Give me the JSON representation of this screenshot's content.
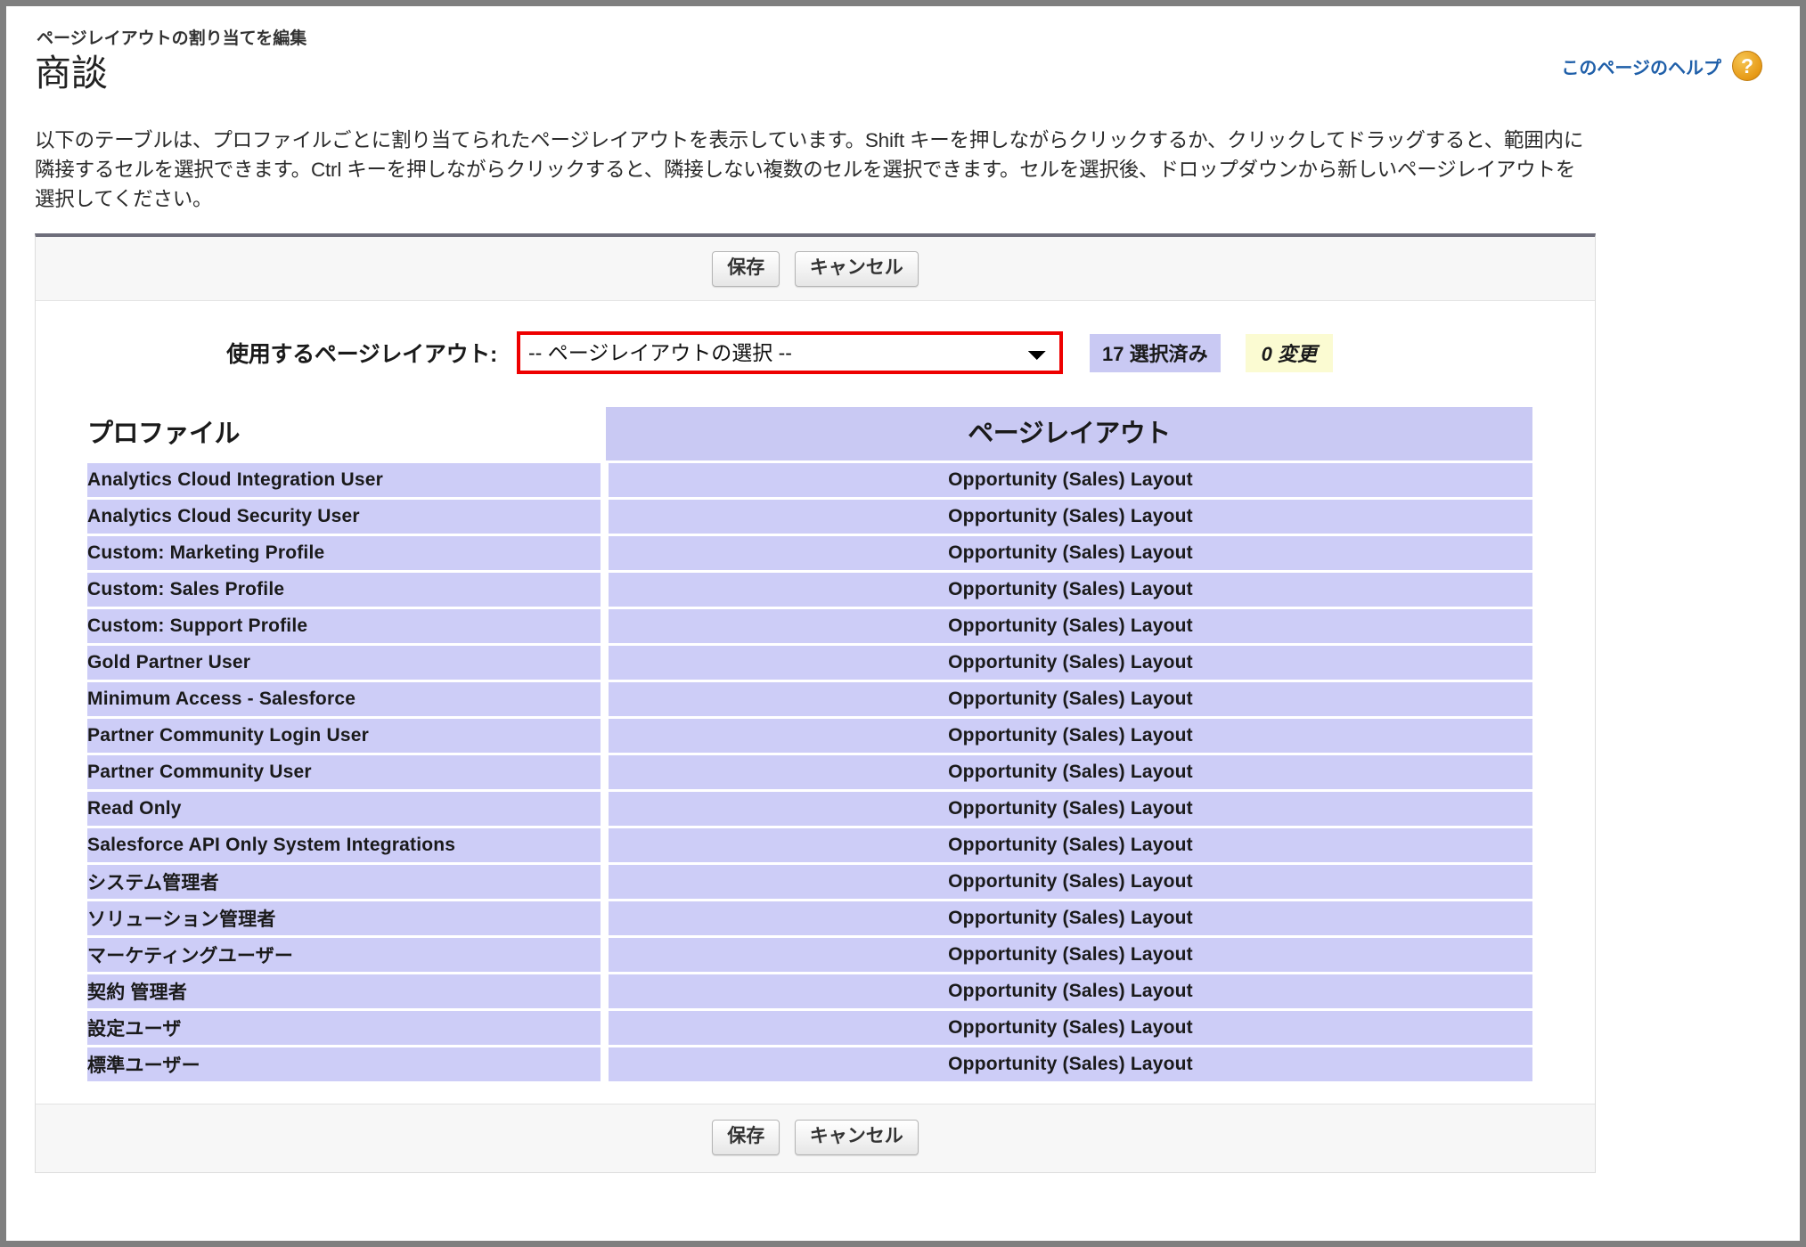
{
  "header": {
    "kicker": "ページレイアウトの割り当てを編集",
    "title": "商談",
    "help_link": "このページのヘルプ",
    "help_icon": "question-mark-icon",
    "help_icon_glyph": "?"
  },
  "description": "以下のテーブルは、プロファイルごとに割り当てられたページレイアウトを表示しています。Shift キーを押しながらクリックするか、クリックしてドラッグすると、範囲内に隣接するセルを選択できます。Ctrl キーを押しながらクリックすると、隣接しない複数のセルを選択できます。セルを選択後、ドロップダウンから新しいページレイアウトを選択してください。",
  "toolbar": {
    "save_label": "保存",
    "cancel_label": "キャンセル"
  },
  "select_row": {
    "label": "使用するページレイアウト:",
    "selected_option": "-- ページレイアウトの選択 --",
    "options": [
      "-- ページレイアウトの選択 --"
    ],
    "selected_badge": "17 選択済み",
    "changed_badge": "0 変更",
    "highlight_color": "#ee0000",
    "selected_badge_color": "#c9c9f3",
    "changed_badge_color": "#fbfbd2"
  },
  "table": {
    "columns": [
      "プロファイル",
      "ページレイアウト"
    ],
    "rows": [
      {
        "profile": "Analytics Cloud Integration User",
        "layout": "Opportunity (Sales) Layout"
      },
      {
        "profile": "Analytics Cloud Security User",
        "layout": "Opportunity (Sales) Layout"
      },
      {
        "profile": "Custom: Marketing Profile",
        "layout": "Opportunity (Sales) Layout"
      },
      {
        "profile": "Custom: Sales Profile",
        "layout": "Opportunity (Sales) Layout"
      },
      {
        "profile": "Custom: Support Profile",
        "layout": "Opportunity (Sales) Layout"
      },
      {
        "profile": "Gold Partner User",
        "layout": "Opportunity (Sales) Layout"
      },
      {
        "profile": "Minimum Access - Salesforce",
        "layout": "Opportunity (Sales) Layout"
      },
      {
        "profile": "Partner Community Login User",
        "layout": "Opportunity (Sales) Layout"
      },
      {
        "profile": "Partner Community User",
        "layout": "Opportunity (Sales) Layout"
      },
      {
        "profile": "Read Only",
        "layout": "Opportunity (Sales) Layout"
      },
      {
        "profile": "Salesforce API Only System Integrations",
        "layout": "Opportunity (Sales) Layout"
      },
      {
        "profile": "システム管理者",
        "layout": "Opportunity (Sales) Layout"
      },
      {
        "profile": "ソリューション管理者",
        "layout": "Opportunity (Sales) Layout"
      },
      {
        "profile": "マーケティングユーザー",
        "layout": "Opportunity (Sales) Layout"
      },
      {
        "profile": "契約 管理者",
        "layout": "Opportunity (Sales) Layout"
      },
      {
        "profile": "設定ユーザ",
        "layout": "Opportunity (Sales) Layout"
      },
      {
        "profile": "標準ユーザー",
        "layout": "Opportunity (Sales) Layout"
      }
    ]
  }
}
